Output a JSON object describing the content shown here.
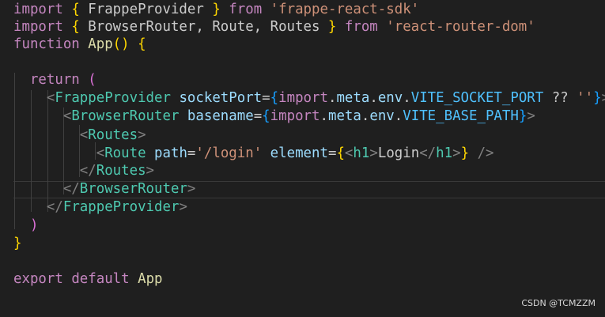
{
  "code_lines": [
    [
      [
        "kw",
        "import"
      ],
      [
        "p",
        " "
      ],
      [
        "b1",
        "{"
      ],
      [
        "p",
        " FrappeProvider "
      ],
      [
        "b1",
        "}"
      ],
      [
        "p",
        " "
      ],
      [
        "kw",
        "from"
      ],
      [
        "p",
        " "
      ],
      [
        "str",
        "'frappe-react-sdk'"
      ]
    ],
    [
      [
        "kw",
        "import"
      ],
      [
        "p",
        " "
      ],
      [
        "b1",
        "{"
      ],
      [
        "p",
        " BrowserRouter, Route, Routes "
      ],
      [
        "b1",
        "}"
      ],
      [
        "p",
        " "
      ],
      [
        "kw",
        "from"
      ],
      [
        "p",
        " "
      ],
      [
        "str",
        "'react-router-dom'"
      ]
    ],
    [
      [
        "kw",
        "function"
      ],
      [
        "p",
        " "
      ],
      [
        "fn",
        "App"
      ],
      [
        "b1",
        "()"
      ],
      [
        "p",
        " "
      ],
      [
        "b1",
        "{"
      ]
    ],
    [],
    [
      [
        "p",
        "  "
      ],
      [
        "kw",
        "return"
      ],
      [
        "p",
        " "
      ],
      [
        "b2",
        "("
      ]
    ],
    [
      [
        "p",
        "    "
      ],
      [
        "angle",
        "<"
      ],
      [
        "tag",
        "FrappeProvider"
      ],
      [
        "p",
        " "
      ],
      [
        "attr",
        "socketPort"
      ],
      [
        "p",
        "="
      ],
      [
        "b3",
        "{"
      ],
      [
        "kw",
        "import"
      ],
      [
        "p",
        "."
      ],
      [
        "var",
        "meta"
      ],
      [
        "p",
        "."
      ],
      [
        "var",
        "env"
      ],
      [
        "p",
        "."
      ],
      [
        "const",
        "VITE_SOCKET_PORT"
      ],
      [
        "p",
        " ?? "
      ],
      [
        "str",
        "''"
      ],
      [
        "b3",
        "}"
      ],
      [
        "angle",
        ">"
      ]
    ],
    [
      [
        "p",
        "      "
      ],
      [
        "angle",
        "<"
      ],
      [
        "tag",
        "BrowserRouter"
      ],
      [
        "p",
        " "
      ],
      [
        "attr",
        "basename"
      ],
      [
        "p",
        "="
      ],
      [
        "b3",
        "{"
      ],
      [
        "kw",
        "import"
      ],
      [
        "p",
        "."
      ],
      [
        "var",
        "meta"
      ],
      [
        "p",
        "."
      ],
      [
        "var",
        "env"
      ],
      [
        "p",
        "."
      ],
      [
        "const",
        "VITE_BASE_PATH"
      ],
      [
        "b3",
        "}"
      ],
      [
        "angle",
        ">"
      ]
    ],
    [
      [
        "p",
        "        "
      ],
      [
        "angle",
        "<"
      ],
      [
        "tag",
        "Routes"
      ],
      [
        "angle",
        ">"
      ]
    ],
    [
      [
        "p",
        "          "
      ],
      [
        "angle",
        "<"
      ],
      [
        "tag",
        "Route"
      ],
      [
        "p",
        " "
      ],
      [
        "attr",
        "path"
      ],
      [
        "p",
        "="
      ],
      [
        "str",
        "'/login'"
      ],
      [
        "p",
        " "
      ],
      [
        "attr",
        "element"
      ],
      [
        "p",
        "="
      ],
      [
        "b1",
        "{"
      ],
      [
        "angle",
        "<"
      ],
      [
        "tag",
        "h1"
      ],
      [
        "angle",
        ">"
      ],
      [
        "p",
        "Login"
      ],
      [
        "angle",
        "</"
      ],
      [
        "tag",
        "h1"
      ],
      [
        "angle",
        ">"
      ],
      [
        "b1",
        "}"
      ],
      [
        "p",
        " "
      ],
      [
        "angle",
        "/>"
      ]
    ],
    [
      [
        "p",
        "        "
      ],
      [
        "angle",
        "</"
      ],
      [
        "tag",
        "Routes"
      ],
      [
        "angle",
        ">"
      ]
    ],
    [
      [
        "p",
        "      "
      ],
      [
        "angle",
        "</"
      ],
      [
        "tag",
        "BrowserRouter"
      ],
      [
        "angle",
        ">"
      ]
    ],
    [
      [
        "p",
        "    "
      ],
      [
        "angle",
        "</"
      ],
      [
        "tag",
        "FrappeProvider"
      ],
      [
        "angle",
        ">"
      ]
    ],
    [
      [
        "p",
        "  "
      ],
      [
        "b2",
        ")"
      ]
    ],
    [
      [
        "b1",
        "}"
      ]
    ],
    [],
    [
      [
        "kw",
        "export"
      ],
      [
        "p",
        " "
      ],
      [
        "kw",
        "default"
      ],
      [
        "p",
        " "
      ],
      [
        "fn",
        "App"
      ]
    ]
  ],
  "watermark": "CSDN @TCMZZM"
}
